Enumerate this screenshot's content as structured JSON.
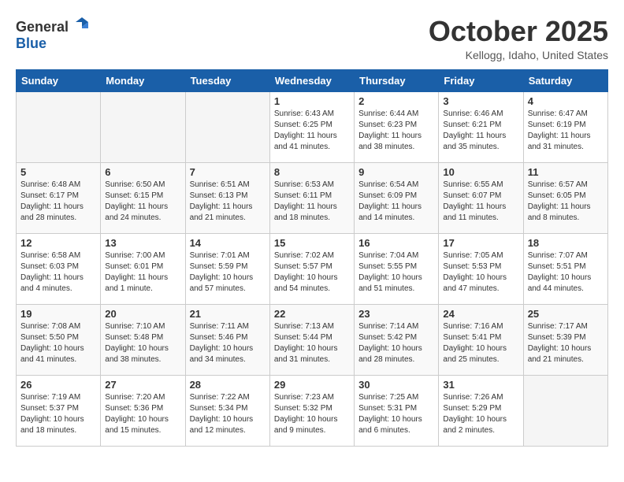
{
  "header": {
    "logo_general": "General",
    "logo_blue": "Blue",
    "month_title": "October 2025",
    "location": "Kellogg, Idaho, United States"
  },
  "days_of_week": [
    "Sunday",
    "Monday",
    "Tuesday",
    "Wednesday",
    "Thursday",
    "Friday",
    "Saturday"
  ],
  "weeks": [
    [
      {
        "day": "",
        "info": ""
      },
      {
        "day": "",
        "info": ""
      },
      {
        "day": "",
        "info": ""
      },
      {
        "day": "1",
        "info": "Sunrise: 6:43 AM\nSunset: 6:25 PM\nDaylight: 11 hours\nand 41 minutes."
      },
      {
        "day": "2",
        "info": "Sunrise: 6:44 AM\nSunset: 6:23 PM\nDaylight: 11 hours\nand 38 minutes."
      },
      {
        "day": "3",
        "info": "Sunrise: 6:46 AM\nSunset: 6:21 PM\nDaylight: 11 hours\nand 35 minutes."
      },
      {
        "day": "4",
        "info": "Sunrise: 6:47 AM\nSunset: 6:19 PM\nDaylight: 11 hours\nand 31 minutes."
      }
    ],
    [
      {
        "day": "5",
        "info": "Sunrise: 6:48 AM\nSunset: 6:17 PM\nDaylight: 11 hours\nand 28 minutes."
      },
      {
        "day": "6",
        "info": "Sunrise: 6:50 AM\nSunset: 6:15 PM\nDaylight: 11 hours\nand 24 minutes."
      },
      {
        "day": "7",
        "info": "Sunrise: 6:51 AM\nSunset: 6:13 PM\nDaylight: 11 hours\nand 21 minutes."
      },
      {
        "day": "8",
        "info": "Sunrise: 6:53 AM\nSunset: 6:11 PM\nDaylight: 11 hours\nand 18 minutes."
      },
      {
        "day": "9",
        "info": "Sunrise: 6:54 AM\nSunset: 6:09 PM\nDaylight: 11 hours\nand 14 minutes."
      },
      {
        "day": "10",
        "info": "Sunrise: 6:55 AM\nSunset: 6:07 PM\nDaylight: 11 hours\nand 11 minutes."
      },
      {
        "day": "11",
        "info": "Sunrise: 6:57 AM\nSunset: 6:05 PM\nDaylight: 11 hours\nand 8 minutes."
      }
    ],
    [
      {
        "day": "12",
        "info": "Sunrise: 6:58 AM\nSunset: 6:03 PM\nDaylight: 11 hours\nand 4 minutes."
      },
      {
        "day": "13",
        "info": "Sunrise: 7:00 AM\nSunset: 6:01 PM\nDaylight: 11 hours\nand 1 minute."
      },
      {
        "day": "14",
        "info": "Sunrise: 7:01 AM\nSunset: 5:59 PM\nDaylight: 10 hours\nand 57 minutes."
      },
      {
        "day": "15",
        "info": "Sunrise: 7:02 AM\nSunset: 5:57 PM\nDaylight: 10 hours\nand 54 minutes."
      },
      {
        "day": "16",
        "info": "Sunrise: 7:04 AM\nSunset: 5:55 PM\nDaylight: 10 hours\nand 51 minutes."
      },
      {
        "day": "17",
        "info": "Sunrise: 7:05 AM\nSunset: 5:53 PM\nDaylight: 10 hours\nand 47 minutes."
      },
      {
        "day": "18",
        "info": "Sunrise: 7:07 AM\nSunset: 5:51 PM\nDaylight: 10 hours\nand 44 minutes."
      }
    ],
    [
      {
        "day": "19",
        "info": "Sunrise: 7:08 AM\nSunset: 5:50 PM\nDaylight: 10 hours\nand 41 minutes."
      },
      {
        "day": "20",
        "info": "Sunrise: 7:10 AM\nSunset: 5:48 PM\nDaylight: 10 hours\nand 38 minutes."
      },
      {
        "day": "21",
        "info": "Sunrise: 7:11 AM\nSunset: 5:46 PM\nDaylight: 10 hours\nand 34 minutes."
      },
      {
        "day": "22",
        "info": "Sunrise: 7:13 AM\nSunset: 5:44 PM\nDaylight: 10 hours\nand 31 minutes."
      },
      {
        "day": "23",
        "info": "Sunrise: 7:14 AM\nSunset: 5:42 PM\nDaylight: 10 hours\nand 28 minutes."
      },
      {
        "day": "24",
        "info": "Sunrise: 7:16 AM\nSunset: 5:41 PM\nDaylight: 10 hours\nand 25 minutes."
      },
      {
        "day": "25",
        "info": "Sunrise: 7:17 AM\nSunset: 5:39 PM\nDaylight: 10 hours\nand 21 minutes."
      }
    ],
    [
      {
        "day": "26",
        "info": "Sunrise: 7:19 AM\nSunset: 5:37 PM\nDaylight: 10 hours\nand 18 minutes."
      },
      {
        "day": "27",
        "info": "Sunrise: 7:20 AM\nSunset: 5:36 PM\nDaylight: 10 hours\nand 15 minutes."
      },
      {
        "day": "28",
        "info": "Sunrise: 7:22 AM\nSunset: 5:34 PM\nDaylight: 10 hours\nand 12 minutes."
      },
      {
        "day": "29",
        "info": "Sunrise: 7:23 AM\nSunset: 5:32 PM\nDaylight: 10 hours\nand 9 minutes."
      },
      {
        "day": "30",
        "info": "Sunrise: 7:25 AM\nSunset: 5:31 PM\nDaylight: 10 hours\nand 6 minutes."
      },
      {
        "day": "31",
        "info": "Sunrise: 7:26 AM\nSunset: 5:29 PM\nDaylight: 10 hours\nand 2 minutes."
      },
      {
        "day": "",
        "info": ""
      }
    ]
  ]
}
